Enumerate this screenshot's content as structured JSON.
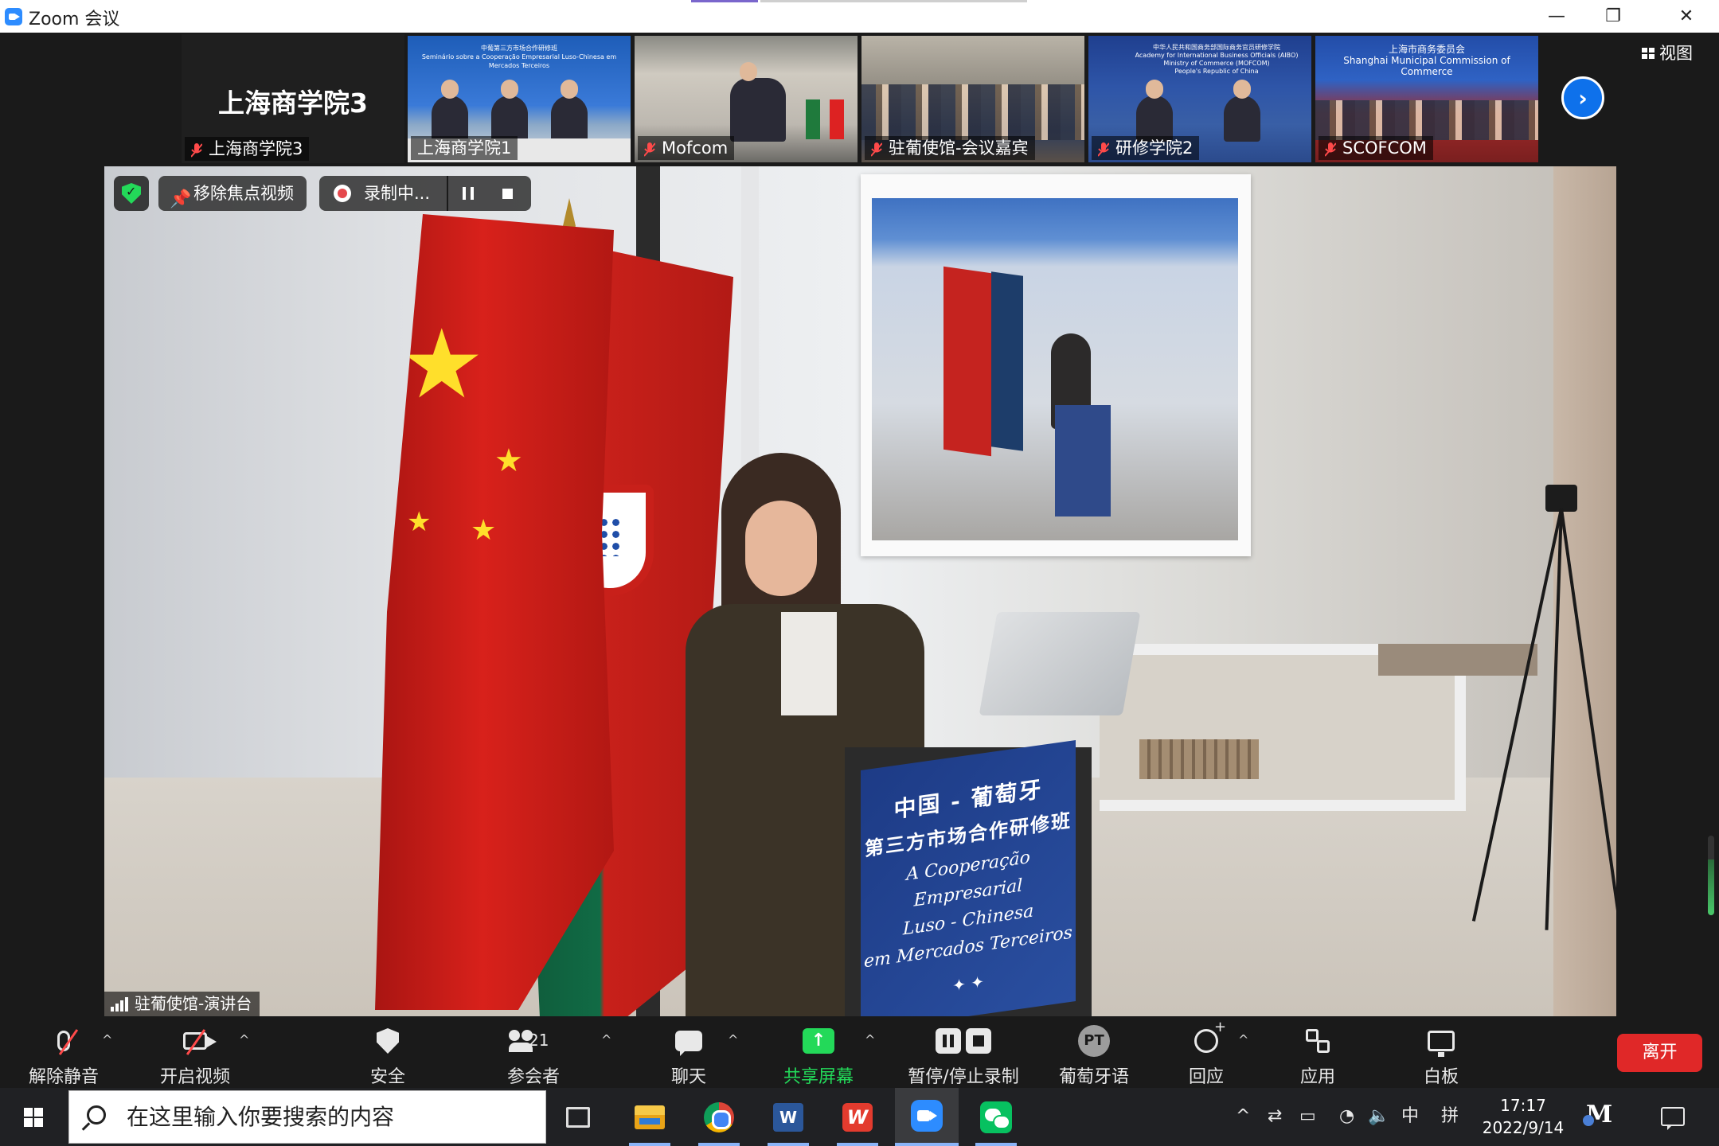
{
  "window": {
    "title": "Zoom 会议",
    "controls": {
      "minimize": "—",
      "restore": "❐",
      "close": "✕"
    }
  },
  "gallery": {
    "self_name_large": "上海商学院3",
    "self_label": "上海商学院3",
    "tiles": [
      {
        "label": "上海商学院1",
        "muted": false,
        "banner": "中葡第三方市场合作研修班\nSeminário sobre a Cooperação Empresarial Luso-Chinesa em Mercados Terceiros"
      },
      {
        "label": "Mofcom",
        "muted": true,
        "banner": ""
      },
      {
        "label": "驻葡使馆-会议嘉宾",
        "muted": true,
        "banner": ""
      },
      {
        "label": "研修学院2",
        "muted": true,
        "banner": "中华人民共和国商务部国际商务官员研修学院\nAcademy for International Business Officials (AIBO)\nMinistry of Commerce (MOFCOM)\nPeople's Republic of China"
      },
      {
        "label": "SCOFCOM",
        "muted": true,
        "banner": "上海市商务委员会\nShanghai Municipal Commission of Commerce"
      }
    ],
    "next_page": "›",
    "view_button": "视图"
  },
  "main_video": {
    "unpin_label": "移除焦点视频",
    "recording_label": "录制中...",
    "speaker_label": "驻葡使馆-演讲台",
    "podium_sign": {
      "line1": "中国 - 葡萄牙",
      "line2": "第三方市场合作研修班",
      "line3": "A Cooperação Empresarial",
      "line4": "Luso - Chinesa",
      "line5": "em Mercados Terceiros"
    }
  },
  "toolbar": {
    "unmute": "解除静音",
    "start_video": "开启视频",
    "security": "安全",
    "participants": "参会者",
    "participants_count": "21",
    "chat": "聊天",
    "share_screen": "共享屏幕",
    "pause_stop_record": "暂停/停止录制",
    "interpretation": "葡萄牙语",
    "interpretation_badge": "PT",
    "reactions": "回应",
    "apps": "应用",
    "whiteboard": "白板",
    "leave": "离开"
  },
  "taskbar": {
    "search_placeholder": "在这里输入你要搜索的内容",
    "ime_mode": "中",
    "ime_layout": "拼",
    "time": "17:17",
    "date": "2022/9/14",
    "word_letter": "W",
    "wps_letter": "W",
    "mail_letter": "M"
  },
  "colors": {
    "accent_blue": "#0e71eb",
    "share_green": "#23d959",
    "leave_red": "#e02828",
    "muted_red": "#ff4a4a"
  }
}
